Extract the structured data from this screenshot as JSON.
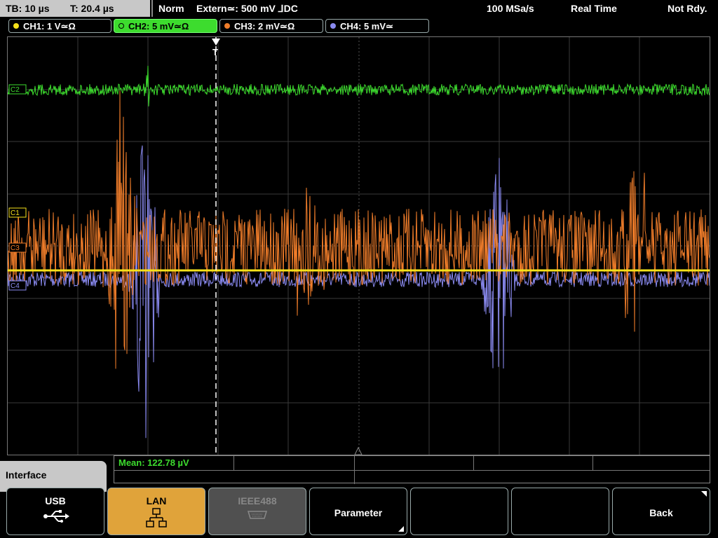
{
  "status_bar": {
    "timebase": "TB: 10 µs",
    "trigger_time": "T: 20.4 µs",
    "mode": "Norm",
    "trigger": "Extern≃: 500 mV ⅃DC",
    "sample_rate": "100 MSa/s",
    "acq_mode": "Real Time",
    "state": "Not Rdy."
  },
  "channels": [
    {
      "label": "CH1: 1 V≃Ω",
      "color": "#f5e11a",
      "active": false
    },
    {
      "label": "CH2: 5 mV≃Ω",
      "color": "#3ddc2e",
      "active": true
    },
    {
      "label": "CH3: 2 mV≃Ω",
      "color": "#f07d2a",
      "active": false
    },
    {
      "label": "CH4: 5 mV≃",
      "color": "#8a8af0",
      "active": false
    }
  ],
  "markers": {
    "c2": "C2",
    "c1": "C1",
    "c3": "C3",
    "c4": "C4",
    "trigger": "T"
  },
  "measurement": {
    "mean": "Mean: 122.78 µV"
  },
  "menu": {
    "title": "Interface"
  },
  "softkeys": {
    "usb": "USB",
    "lan": "LAN",
    "ieee": "IEEE488",
    "parameter": "Parameter",
    "back": "Back"
  },
  "icons": {
    "usb": "usb-icon",
    "lan": "lan-network-icon",
    "ieee": "ieee488-connector-icon"
  },
  "colors": {
    "ch1": "#f5e11a",
    "ch2": "#3ddc2e",
    "ch3": "#f07d2a",
    "ch4": "#8a8af0",
    "accent": "#e0a33a"
  }
}
